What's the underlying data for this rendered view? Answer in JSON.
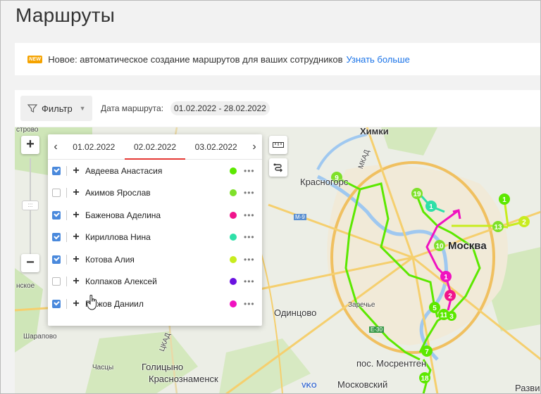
{
  "page": {
    "title": "Маршруты"
  },
  "banner": {
    "badge": "NEW",
    "text": "Новое: автоматическое создание маршрутов для ваших сотрудников",
    "link": "Узнать больше"
  },
  "toolbar": {
    "filter_label": "Фильтр",
    "date_label": "Дата маршрута:",
    "date_range": "01.02.2022 - 28.02.2022"
  },
  "panel": {
    "dates": [
      "01.02.2022",
      "02.02.2022",
      "03.02.2022"
    ],
    "active_date_index": 1,
    "employees": [
      {
        "name": "Авдеева Анастасия",
        "checked": true,
        "color": "#5ce800"
      },
      {
        "name": "Акимов Ярослав",
        "checked": false,
        "color": "#7fe02a"
      },
      {
        "name": "Баженова Аделина",
        "checked": true,
        "color": "#f0148c"
      },
      {
        "name": "Кириллова Нина",
        "checked": true,
        "color": "#2ee0a8"
      },
      {
        "name": "Котова Алия",
        "checked": true,
        "color": "#c8ec1e"
      },
      {
        "name": "Колпаков Алексей",
        "checked": false,
        "color": "#6a12e0"
      },
      {
        "name": "Рыжов Даниил",
        "checked": true,
        "color": "#f012c0"
      }
    ]
  },
  "map": {
    "labels": {
      "khimki": "Химки",
      "krasnogorsk": "Красногорс",
      "moscow": "Москва",
      "odintsovo": "Одинцово",
      "zarechye": "Заречье",
      "mosrentgen": "пос. Мосрентген",
      "golitsyno": "Голицыно",
      "krasnoznamensk": "Краснознаменск",
      "moskovsky": "Московский",
      "sharapovo": "Шарапово",
      "chasy": "Часцы",
      "strovo": "строво",
      "nskoe": "нское",
      "razvi": "Разви",
      "mkad": "МКАД",
      "tskad": "ЦКАД",
      "m9": "М-9",
      "e30": "Е-30",
      "vko": "VKO"
    },
    "markers": [
      "9",
      "19",
      "1",
      "1",
      "13",
      "2",
      "1",
      "2",
      "5",
      "11",
      "3",
      "7",
      "18",
      "10"
    ]
  },
  "colors": {
    "link": "#1a73e8",
    "badge": "#f5a300",
    "checkbox": "#4a89dc",
    "active_tab": "#e53935"
  }
}
